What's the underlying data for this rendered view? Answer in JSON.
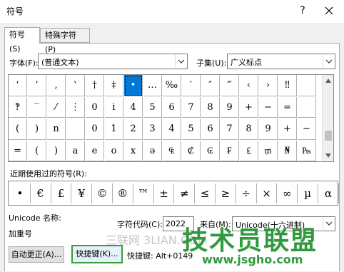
{
  "window": {
    "title": "符号",
    "help": "?"
  },
  "tabs": [
    {
      "label": "符号(S)"
    },
    {
      "label": "特殊字符(P)"
    }
  ],
  "font": {
    "label": "字体(F):",
    "value": "(普通文本)"
  },
  "subset": {
    "label": "子集(U):",
    "value": "广义标点"
  },
  "grid": {
    "rows": [
      [
        "‘",
        "’",
        "‚",
        "‛",
        "†",
        "‡",
        "•",
        "…",
        "‰",
        "′",
        "″",
        "‴",
        "‹",
        "›",
        "‼",
        ""
      ],
      [
        "‽",
        "‾",
        "⁄",
        "⋮",
        "0",
        "i",
        "4",
        "5",
        "6",
        "7",
        "8",
        "9",
        "+",
        "−",
        "=",
        ""
      ],
      [
        "(",
        ")",
        "n",
        "",
        "0",
        "1",
        "2",
        "3",
        "4",
        "5",
        "6",
        "7",
        "8",
        "9",
        "+",
        "−"
      ],
      [
        "=",
        "(",
        ")",
        "a",
        "e",
        "o",
        "x",
        "ə",
        "₠",
        "₡",
        "₢",
        "₣",
        "₤",
        "₥",
        "₦",
        "₧",
        "₨"
      ]
    ],
    "selected": "•"
  },
  "recent": {
    "label": "近期使用过的符号(R):",
    "symbols": [
      "•",
      "€",
      "£",
      "¥",
      "©",
      "®",
      "™",
      "±",
      "≠",
      "≤",
      "≥",
      "÷",
      "×",
      "∞",
      "µ",
      "α"
    ]
  },
  "unicode_name": {
    "label": "Unicode 名称:",
    "value": "加重号"
  },
  "char_code": {
    "label": "字符代码(C):",
    "value": "2022"
  },
  "from": {
    "label": "来自(M):",
    "value": "Unicode(十六进制)"
  },
  "buttons": {
    "autocorrect": "自动更正(A)...",
    "shortcut_key": "快捷键(K)..."
  },
  "shortcut_text": "快捷键: Alt+0149",
  "watermark": "三联网 3LIAN.COM",
  "brand": {
    "name": "技术员联盟",
    "url": "www.jsgho.com"
  }
}
